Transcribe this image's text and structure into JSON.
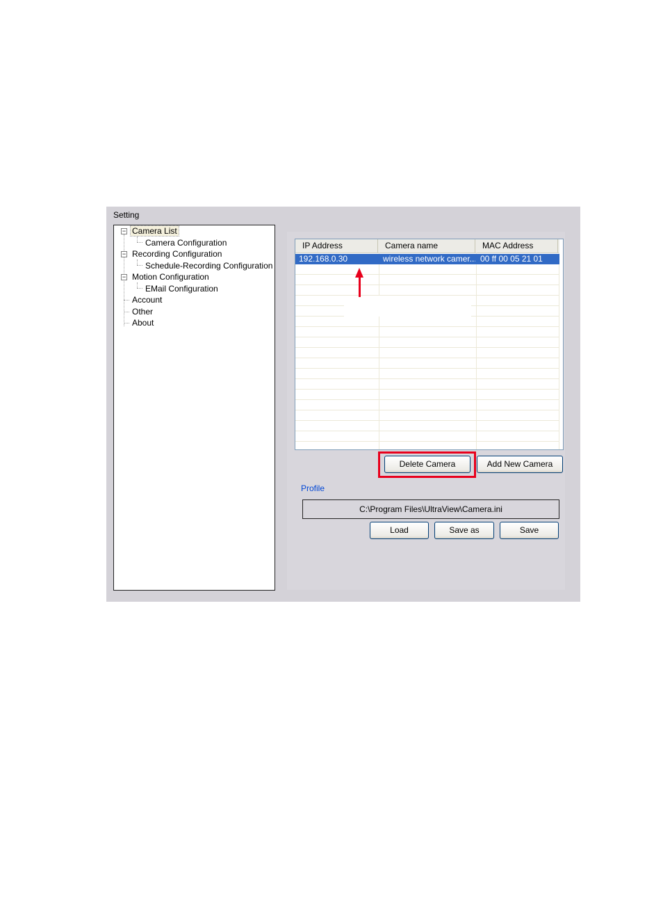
{
  "dialog": {
    "title": "Setting"
  },
  "tree": {
    "items": [
      {
        "label": "Camera List",
        "expander": "⊟"
      },
      {
        "label": "Camera Configuration"
      },
      {
        "label": "Recording Configuration",
        "expander": "⊟"
      },
      {
        "label": "Schedule-Recording Configuration"
      },
      {
        "label": "Motion Configuration",
        "expander": "⊟"
      },
      {
        "label": "EMail Configuration"
      },
      {
        "label": "Account"
      },
      {
        "label": "Other"
      },
      {
        "label": "About"
      }
    ]
  },
  "camera_list": {
    "columns": [
      "IP Address",
      "Camera name",
      "MAC Address"
    ],
    "rows": [
      {
        "ip": "192.168.0.30",
        "name": "wireless network camer...",
        "mac": "00 ff 00 05 21 01"
      }
    ]
  },
  "buttons": {
    "delete_camera": "Delete Camera",
    "add_new_camera": "Add New Camera",
    "load": "Load",
    "save_as": "Save as",
    "save": "Save"
  },
  "profile": {
    "label": "Profile",
    "path": "C:\\Program Files\\UltraView\\Camera.ini"
  },
  "colors": {
    "selection": "#316ac5",
    "annotation_red": "#e8001c",
    "profile_label": "#0046d5"
  }
}
